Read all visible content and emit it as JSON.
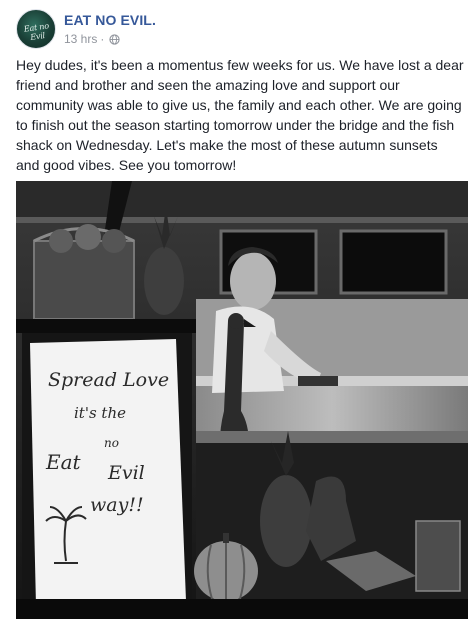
{
  "post": {
    "page_name": "EAT NO EVIL.",
    "timestamp": "13 hrs",
    "separator": "·",
    "avatar_text": "Eat no Evil",
    "audience_icon": "globe-icon",
    "body_text": "Hey dudes, it's been a momentus few weeks for us. We have lost a dear friend and brother and seen the amazing love and support our community was able to give us, the family and each other. We are going to finish out the season starting tomorrow under the bridge and the fish shack on Wednesday. Let's make the most of these autumn sunsets and good vibes. See you tomorrow!"
  },
  "photo": {
    "sign_lines": [
      "Spread Love",
      "it's the",
      "Eat",
      "no",
      "Evil",
      "way!!"
    ]
  },
  "colors": {
    "link_blue": "#365899",
    "meta_gray": "#90949c",
    "text": "#1d2129"
  }
}
